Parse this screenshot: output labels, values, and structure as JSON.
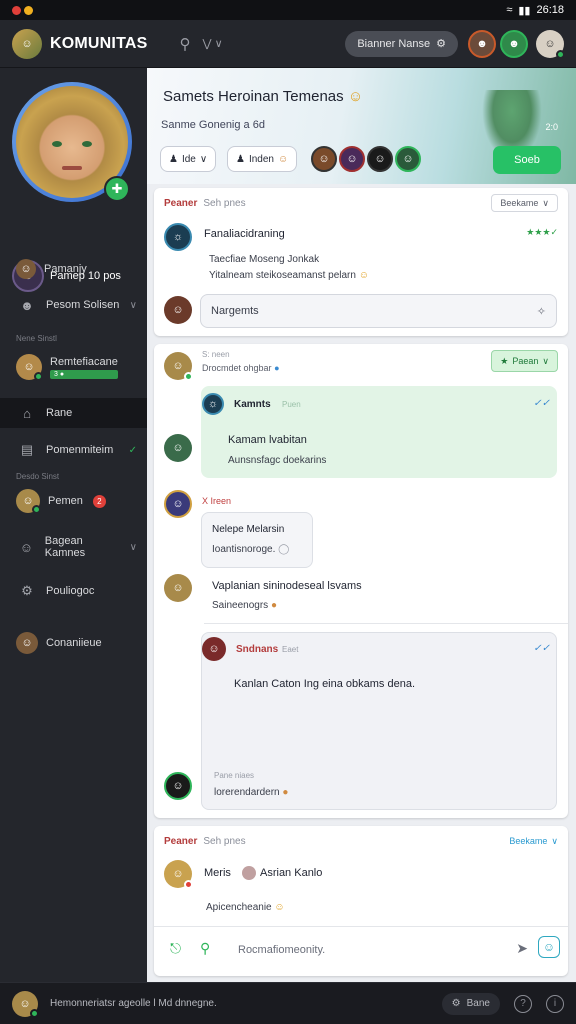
{
  "status_bar": {
    "time": "26:18"
  },
  "header": {
    "title": "KOMUNITAS",
    "action_label": "Bianner Nanse"
  },
  "sidebar": {
    "profile_name": "Pamep 10 pos",
    "items": [
      {
        "label": "Pamanjy"
      },
      {
        "label": "Pesom Solisen"
      },
      {
        "label": "Rane"
      },
      {
        "label": "Pomenmiteim"
      },
      {
        "label": "Bagean Kamnes"
      },
      {
        "label": "Pouliogoc"
      },
      {
        "label": "Conaniieue"
      }
    ],
    "group_a_caption": "Nene Sinstl",
    "group_a_name": "Remtefiacane",
    "group_a_tag": "3 ●",
    "group_b_caption": "Desdo Sinst",
    "group_b_name": "Pemen",
    "group_b_badge": "2"
  },
  "hero": {
    "title": "Samets Heroinan Temenas",
    "subtitle": "Sanme Gonenig a 6d",
    "score": "2:0",
    "chip1": "Ide",
    "chip2": "Inden",
    "action": "Soeb"
  },
  "card1": {
    "head_a": "Peaner",
    "head_b": "Seh pnes",
    "tag": "Beekame",
    "post_title": "Fanaliacidraning",
    "post_line1": "Taecfiae Moseng Jonkak",
    "post_line2": "Yitalneam steikoseamanst pelarn",
    "reply_placeholder": "Nargemts"
  },
  "card2": {
    "caption": "S: neen",
    "author_line": "Drocmdet ohgbar",
    "tag": "Paean",
    "msg1_author": "Kamnts",
    "msg1_time": "Puen",
    "msg1_text": "Kamam lvabitan",
    "msg1_sub": "Aunsnsfagc doekarins",
    "msg2_caption": "X Ireen",
    "msg2_line1": "Nelepe Melarsin",
    "msg2_line2": "Ioantisnoroge.",
    "msg3_line1": "Vaplanian sininodeseal lsvams",
    "msg3_line2": "Saineenogrs",
    "msg4_author": "Sndnans",
    "msg4_time": "Eaet",
    "msg4_text": "Kanlan Caton Ing eina obkams dena.",
    "msg4_caption": "Pane niaes",
    "msg4_sub": "lorerendardern"
  },
  "card3": {
    "head_a": "Peaner",
    "head_b": "Seh pnes",
    "tag": "Beekame",
    "author": "Meris",
    "author2": "Asrian Kanlo",
    "sub": "Apicencheanie",
    "compose_placeholder": "Rocmafiomeonity."
  },
  "bottombar": {
    "text": "Hemonneriatsr ageolle l Md dnnegne.",
    "button": "Bane"
  }
}
